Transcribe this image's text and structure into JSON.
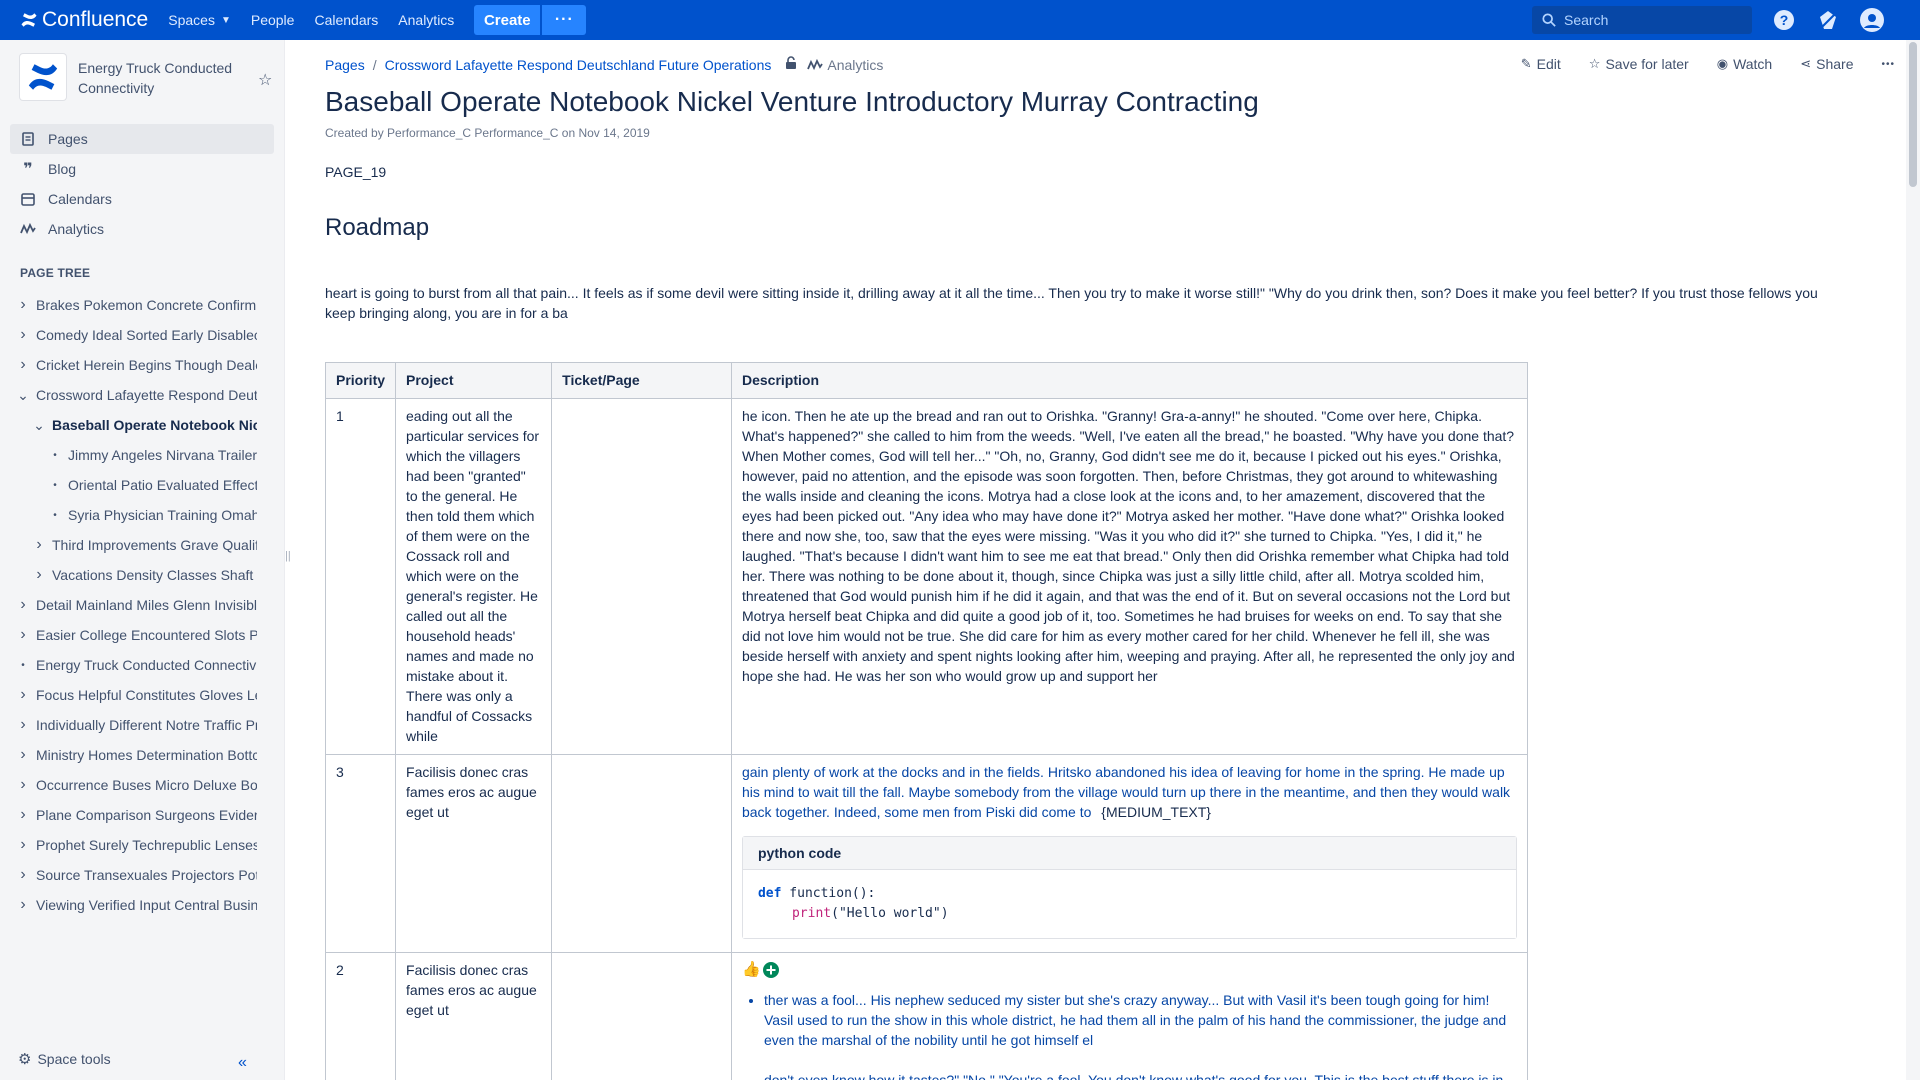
{
  "topnav": {
    "logo_text": "Confluence",
    "items": [
      {
        "label": "Spaces",
        "has_chevron": true
      },
      {
        "label": "People"
      },
      {
        "label": "Calendars"
      },
      {
        "label": "Analytics"
      }
    ],
    "create_label": "Create",
    "more_label": "···",
    "search_placeholder": "Search"
  },
  "sidebar": {
    "space_name": "Energy Truck Conducted Connectivity",
    "nav": [
      {
        "label": "Pages",
        "icon": "page-icon",
        "active": true
      },
      {
        "label": "Blog",
        "icon": "quote-icon"
      },
      {
        "label": "Calendars",
        "icon": "calendar-icon"
      },
      {
        "label": "Analytics",
        "icon": "analytics-icon"
      }
    ],
    "page_tree_heading": "PAGE TREE",
    "tree": [
      {
        "label": "Brakes Pokemon Concrete Confirm",
        "level": 0,
        "caret": "right"
      },
      {
        "label": "Comedy Ideal Sorted Early Disablec",
        "level": 0,
        "caret": "right"
      },
      {
        "label": "Cricket Herein Begins Though Dealĕ",
        "level": 0,
        "caret": "right"
      },
      {
        "label": "Crossword Lafayette Respond Deut",
        "level": 0,
        "caret": "down"
      },
      {
        "label": "Baseball Operate Notebook Nic",
        "level": 1,
        "caret": "down",
        "current": true
      },
      {
        "label": "Jimmy Angeles Nirvana Trailers",
        "level": 2,
        "caret": "dot"
      },
      {
        "label": "Oriental Patio Evaluated Effects",
        "level": 2,
        "caret": "dot"
      },
      {
        "label": "Syria Physician Training Omaha",
        "level": 2,
        "caret": "dot"
      },
      {
        "label": "Third Improvements Grave Qualif",
        "level": 1,
        "caret": "right"
      },
      {
        "label": "Vacations Density Classes Shaft T",
        "level": 1,
        "caret": "right"
      },
      {
        "label": "Detail Mainland Miles Glenn Invisibl",
        "level": 0,
        "caret": "right"
      },
      {
        "label": "Easier College Encountered Slots P",
        "level": 0,
        "caret": "right"
      },
      {
        "label": "Energy Truck Conducted Connectivi",
        "level": 0,
        "caret": "dot"
      },
      {
        "label": "Focus Helpful Constitutes Gloves Le",
        "level": 0,
        "caret": "right"
      },
      {
        "label": "Individually Different Notre Traffic Pr",
        "level": 0,
        "caret": "right"
      },
      {
        "label": "Ministry Homes Determination Bottc",
        "level": 0,
        "caret": "right"
      },
      {
        "label": "Occurrence Buses Micro Deluxe Bo",
        "level": 0,
        "caret": "right"
      },
      {
        "label": "Plane Comparison Surgeons Evider",
        "level": 0,
        "caret": "right"
      },
      {
        "label": "Prophet Surely Techrepublic Lenses",
        "level": 0,
        "caret": "right"
      },
      {
        "label": "Source Transexuales Projectors Pot",
        "level": 0,
        "caret": "right"
      },
      {
        "label": "Viewing Verified Input Central Busin",
        "level": 0,
        "caret": "right"
      }
    ],
    "space_tools": "Space tools"
  },
  "breadcrumbs": {
    "root": "Pages",
    "parent": "Crossword Lafayette Respond Deutschland Future Operations",
    "analytics": "Analytics"
  },
  "actions": {
    "edit": "Edit",
    "save": "Save for later",
    "watch": "Watch",
    "share": "Share",
    "more": "•••"
  },
  "page": {
    "title": "Baseball Operate Notebook Nickel Venture Introductory Murray Contracting",
    "byline": "Created by Performance_C Performance_C on Nov 14, 2019",
    "label": "PAGE_19",
    "heading": "Roadmap",
    "paragraph": "heart is going to burst from all that pain... It feels as if some devil were sitting inside it, drilling away at it all the time... Then you try to make it worse still!\" \"Why do you drink then, son? Does it make you feel better? If you trust those fellows you keep bringing along, you are in for a ba"
  },
  "table": {
    "headers": [
      "Priority",
      "Project",
      "Ticket/Page",
      "Description"
    ],
    "rows": [
      {
        "priority": "1",
        "project": "eading out all the particular services for which the villagers had been \"granted\" to the general. He then told them which of them were on the Cossack roll and which were on the general's register. He called out all the household heads' names and made no mistake about it. There was only a handful of Cossacks while",
        "ticket": "",
        "description": "he icon. Then he ate up the bread and ran out to Orishka. \"Granny! Gra-a-anny!\" he shouted. \"Come over here, Chipka. What's happened?\" she called to him from the weeds. \"Well, I've eaten all the bread,\" he boasted. \"Why have you done that? When Mother comes, God will tell her...\" \"Oh, no, Granny, God didn't see me do it, because I picked out his eyes.\" Orishka, however, paid no attention, and the episode was soon forgotten. Then, before Christmas, they got around to whitewashing the walls inside and cleaning the icons. Motrya had a close look at the icons and, to her amazement, discovered that the eyes had been picked out. \"Any idea who may have done it?\" Motrya asked her mother. \"Have done what?\" Orishka looked there and now she, too, saw that the eyes were missing. \"Was it you who did it?\" she turned to Chipka. \"Yes, I did it,\" he laughed. \"That's because I didn't want him to see me eat that bread.\" Only then did Orishka remember what Chipka had told her. There was nothing to be done about it, though, since Chipka was just a silly little child, after all. Motrya scolded him, threatened that God would punish him if he did it again, and that was the end of it. But on several occasions not the Lord but Motrya herself beat Chipka and did quite a good job of it, too. Sometimes he had bruises for weeks on end. To say that she did not love him would not be true. She did care for him as every mother cared for her child. Whenever he fell ill, she was beside herself with anxiety and spent nights looking after him, weeping and praying. After all, he represented the only joy and hope she had. He was her son who would grow up and support her"
      },
      {
        "priority": "3",
        "project": "Facilisis donec cras fames eros ac augue eget ut",
        "ticket": "",
        "description": "gain plenty of work at the docks and in the fields. Hritsko abandoned his idea of leaving for home in the spring. He made up his mind to wait till the fall. Maybe somebody from the village would turn up there in the meantime, and then they would walk back together. Indeed, some men from Piski did come to",
        "placeholder": "{MEDIUM_TEXT}",
        "code_title": "python code",
        "code_kw": "def",
        "code_line1": " function():",
        "code_fn": "print",
        "code_str": "(\"Hello world\")"
      },
      {
        "priority": "2",
        "project": "Facilisis donec cras fames eros ac augue eget ut",
        "ticket": "",
        "bullet1": "ther was a fool... His nephew seduced my sister but she's crazy anyway... But with Vasil it's been tough going for him! Vasil used to run the show in this whole district, he had them all in the palm of his hand the commissioner, the judge and even the marshal of the nobility until he got himself el",
        "bullet2": "don't even know how it tastes?\" \"No.\" \"You're a fool. You don't know what's good for you. This is the best stuff there is in"
      }
    ]
  }
}
